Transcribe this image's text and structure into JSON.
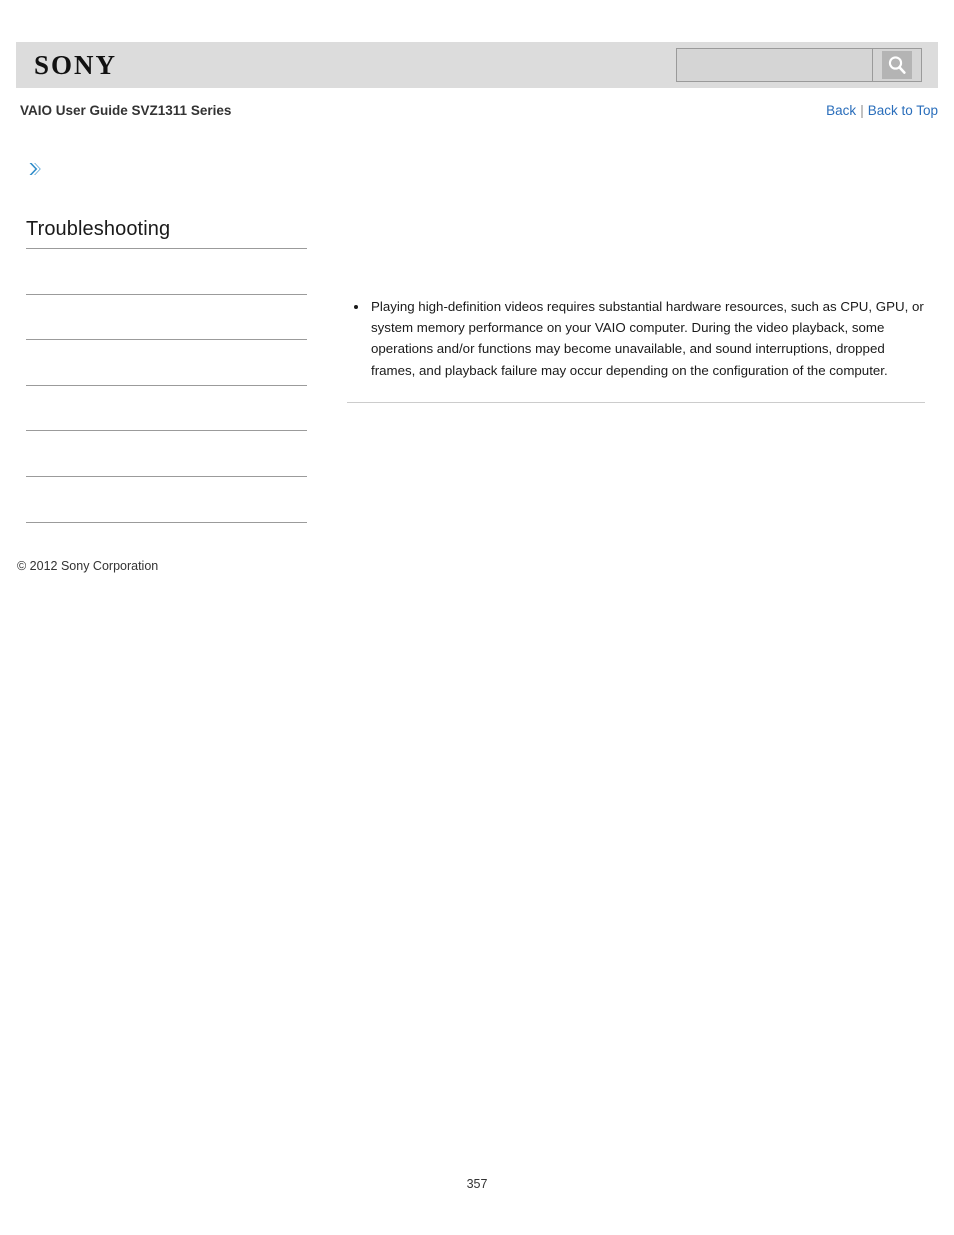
{
  "header": {
    "logo_text": "SONY",
    "search": {
      "value": "",
      "placeholder": "",
      "icon": "search-icon",
      "button_label": ""
    }
  },
  "subheader": {
    "guide_title": "VAIO User Guide SVZ1311 Series",
    "nav": {
      "back_label": "Back",
      "separator": "|",
      "back_to_top_label": "Back to Top"
    }
  },
  "sidebar": {
    "breadcrumb_icon": "chevron-right-icon",
    "section_title": "Troubleshooting",
    "items": [
      {
        "label": ""
      },
      {
        "label": ""
      },
      {
        "label": ""
      },
      {
        "label": ""
      },
      {
        "label": ""
      },
      {
        "label": ""
      }
    ]
  },
  "main": {
    "bullets": [
      "Playing high-definition videos requires substantial hardware resources, such as CPU, GPU, or system memory performance on your VAIO computer. During the video playback, some operations and/or functions may become unavailable, and sound interruptions, dropped frames, and playback failure may occur depending on the configuration of the computer."
    ]
  },
  "footer": {
    "copyright": "© 2012 Sony Corporation",
    "page_number": "357"
  },
  "colors": {
    "header_band": "#dcdcdc",
    "link_blue": "#2a6ebb",
    "chevron_blue": "#2e8bc9",
    "rule_gray": "#9b9b9b",
    "content_rule_gray": "#cccccc"
  }
}
